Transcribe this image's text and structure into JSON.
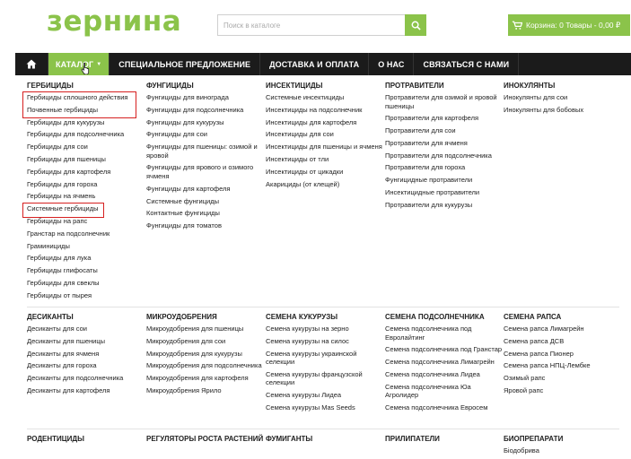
{
  "header": {
    "logo": "зернина",
    "search_placeholder": "Поиск в каталоге",
    "cart_label": "Корзина: 0 Товары - 0,00 ₽"
  },
  "nav": {
    "home_icon": "home-icon",
    "items": [
      "КАТАЛОГ",
      "СПЕЦИАЛЬНОЕ ПРЕДЛОЖЕНИЕ",
      "ДОСТАВКА И ОПЛАТА",
      "О НАС",
      "СВЯЗАТЬСЯ С НАМИ"
    ]
  },
  "menu": {
    "row1": [
      {
        "title": "ГЕРБИЦИДЫ",
        "items": [
          "Гербициды сплошного действия",
          "Почвенные гербициды",
          "Гербициды для кукурузы",
          "Гербициды для подсолнечника",
          "Гербициды для сои",
          "Гербициды для пшеницы",
          "Гербициды для картофеля",
          "Гербициды для гороха",
          "Гербициды на ячмень",
          "Системные гербициды",
          "Гербициды на рапс",
          "Гранстар на подсолнечник",
          "Граминициды",
          "Гербициды для лука",
          "Гербициды глифосаты",
          "Гербициды для свеклы",
          "Гербициды от пырея"
        ]
      },
      {
        "title": "ФУНГИЦИДЫ",
        "items": [
          "Фунгициды для винограда",
          "Фунгициды для подсолнечника",
          "Фунгициды для кукурузы",
          "Фунгициды для сои",
          "Фунгициды для пшеницы: озимой и яровой",
          "Фунгициды для ярового и озимого ячменя",
          "Фунгициды для картофеля",
          "Системные фунгициды",
          "Контактные фунгициды",
          "Фунгициды для томатов"
        ]
      },
      {
        "title": "ИНСЕКТИЦИДЫ",
        "items": [
          "Системные инсектициды",
          "Инсектициды на подсолнечник",
          "Инсектициды для картофеля",
          "Инсектициды для сои",
          "Инсектициды для пшеницы и ячменя",
          "Инсектициды от тли",
          "Инсектициды от цикадки",
          "Акарициды (от клещей)"
        ]
      },
      {
        "title": "ПРОТРАВИТЕЛИ",
        "items": [
          "Протравители для озимой и яровой пшеницы",
          "Протравители для картофеля",
          "Протравители для сои",
          "Протравители для ячменя",
          "Протравители для подсолнечника",
          "Протравители для гороха",
          "Фунгицидные протравители",
          "Инсектицидные протравители",
          "Протравители для кукурузы"
        ]
      },
      {
        "title": "ИНОКУЛЯНТЫ",
        "items": [
          "Инокулянты для сои",
          "Инокулянты для бобовых"
        ]
      }
    ],
    "row2": [
      {
        "title": "ДЕСИКАНТЫ",
        "items": [
          "Десиканты для сои",
          "Десиканты для пшеницы",
          "Десиканты для ячменя",
          "Десиканты для гороха",
          "Десиканты для подсолнечника",
          "Десиканты для картофеля"
        ]
      },
      {
        "title": "МИКРОУДОБРЕНИЯ",
        "items": [
          "Микроудобрения для пшеницы",
          "Микроудобрения для сои",
          "Микроудобрения для кукурузы",
          "Микроудобрения для подсолнечника",
          "Микроудобрения для картофеля",
          "Микроудобрения Ярило"
        ]
      },
      {
        "title": "СЕМЕНА КУКУРУЗЫ",
        "items": [
          "Семена кукурузы на зерно",
          "Семена кукурузы на силос",
          "Семена кукурузы украинской селекции",
          "Семена кукурузы французской селекции",
          "Семена кукурузы Лидеа",
          "Семена кукурузы Mas Seeds"
        ]
      },
      {
        "title": "СЕМЕНА ПОДСОЛНЕЧНИКА",
        "items": [
          "Семена подсолнечника под Евролайтинг",
          "Семена подсолнечника под Гранстар",
          "Семена подсолнечника Лимагрейн",
          "Семена подсолнечника Лидеа",
          "Семена подсолнечника Юа Агролидер",
          "Семена подсолнечника Евросем"
        ]
      },
      {
        "title": "СЕМЕНА РАПСА",
        "items": [
          "Семена рапса Лимагрейн",
          "Семена рапса ДСВ",
          "Семена рапса Пионер",
          "Семена рапса НПЦ-Лембке",
          "Озимый рапс",
          "Яровой рапс"
        ]
      }
    ],
    "row3": [
      {
        "title": "РОДЕНТИЦИДЫ",
        "items": []
      },
      {
        "title": "РЕГУЛЯТОРЫ РОСТА РАСТЕНИЙ",
        "items": []
      },
      {
        "title": "ФУМИГАНТЫ",
        "items": []
      },
      {
        "title": "ПРИЛИПАТЕЛИ",
        "items": []
      },
      {
        "title": "БИОПРЕПАРАТИ",
        "items": [
          "Біодобрива"
        ]
      }
    ]
  },
  "colors": {
    "accent": "#8bc34a",
    "nav_bg": "#1b1b1b",
    "highlight": "#d62020"
  }
}
